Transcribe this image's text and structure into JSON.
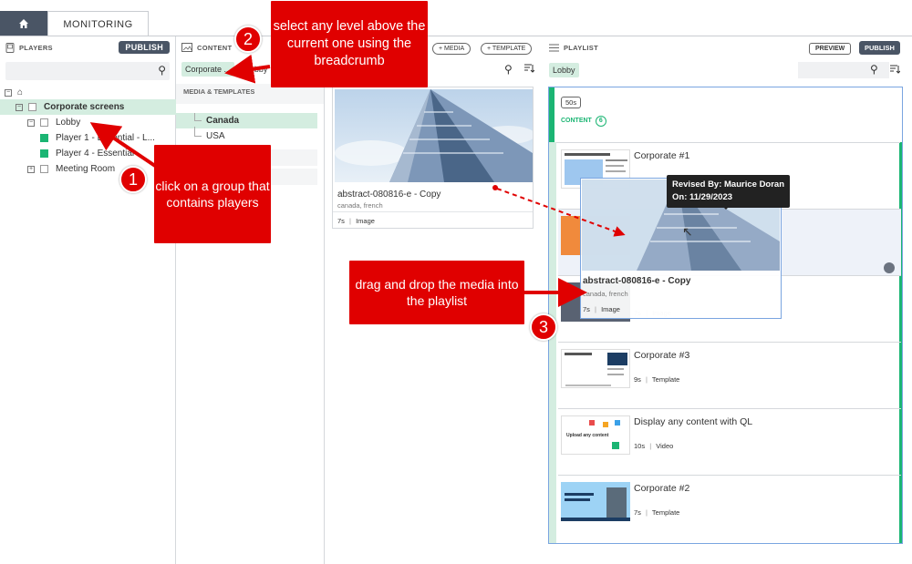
{
  "tabs": {
    "home_icon": "home-icon",
    "monitoring": "MONITORING"
  },
  "players": {
    "header": "PLAYERS",
    "publish": "PUBLISH",
    "tree": [
      {
        "label": "",
        "level": 0
      },
      {
        "label": "Corporate screens",
        "level": 1
      },
      {
        "label": "Lobby",
        "level": 2
      },
      {
        "label": "Player 1 - Essential - L...",
        "level": 3
      },
      {
        "label": "Player 4 - Essential",
        "level": 3
      },
      {
        "label": "Meeting Room",
        "level": 2
      }
    ]
  },
  "content": {
    "header": "CONTENT",
    "add_media": "+ MEDIA",
    "add_template": "+ TEMPLATE",
    "breadcrumb_chip": "Corporate ...",
    "breadcrumb_next": "obby",
    "section_title": "MEDIA & TEMPLATES",
    "folders": [
      "Canada",
      "USA"
    ]
  },
  "media_card": {
    "title": "abstract-080816-e - Copy",
    "tags": "canada, french",
    "duration": "7s",
    "type": "Image"
  },
  "playlist": {
    "header": "PLAYLIST",
    "preview": "PREVIEW",
    "publish": "PUBLISH",
    "breadcrumb": "Lobby",
    "duration_badge": "50s",
    "content_label": "CONTENT",
    "content_count": "6",
    "items": [
      {
        "title": "Corporate #1",
        "duration": "",
        "type": ""
      },
      {
        "title": "",
        "duration": "",
        "type": ""
      },
      {
        "title": "",
        "duration": "7s",
        "type": "Image"
      },
      {
        "title": "Corporate #3",
        "duration": "9s",
        "type": "Template"
      },
      {
        "title": "Display any content with QL",
        "duration": "10s",
        "type": "Video"
      },
      {
        "title": "Corporate #2",
        "duration": "7s",
        "type": "Template"
      }
    ]
  },
  "drag_ghost": {
    "title": "abstract-080816-e - Copy",
    "tags": "canada, french",
    "duration": "7s",
    "type": "Image"
  },
  "tooltip": {
    "line1": "Revised By: Maurice Doran",
    "line2": "On: 11/29/2023"
  },
  "annotations": {
    "a1": "click on a group that contains players",
    "a2": "select any level above the current one using the breadcrumb",
    "a3": "drag and drop the media into the playlist",
    "n1": "1",
    "n2": "2",
    "n3": "3"
  },
  "thumb_texts": {
    "t5": "Upload any content"
  },
  "colors": {
    "accent_green": "#1bb573",
    "dark_btn": "#4a5565",
    "annotation_red": "#e00000",
    "selection_bg": "#d4ede0"
  }
}
